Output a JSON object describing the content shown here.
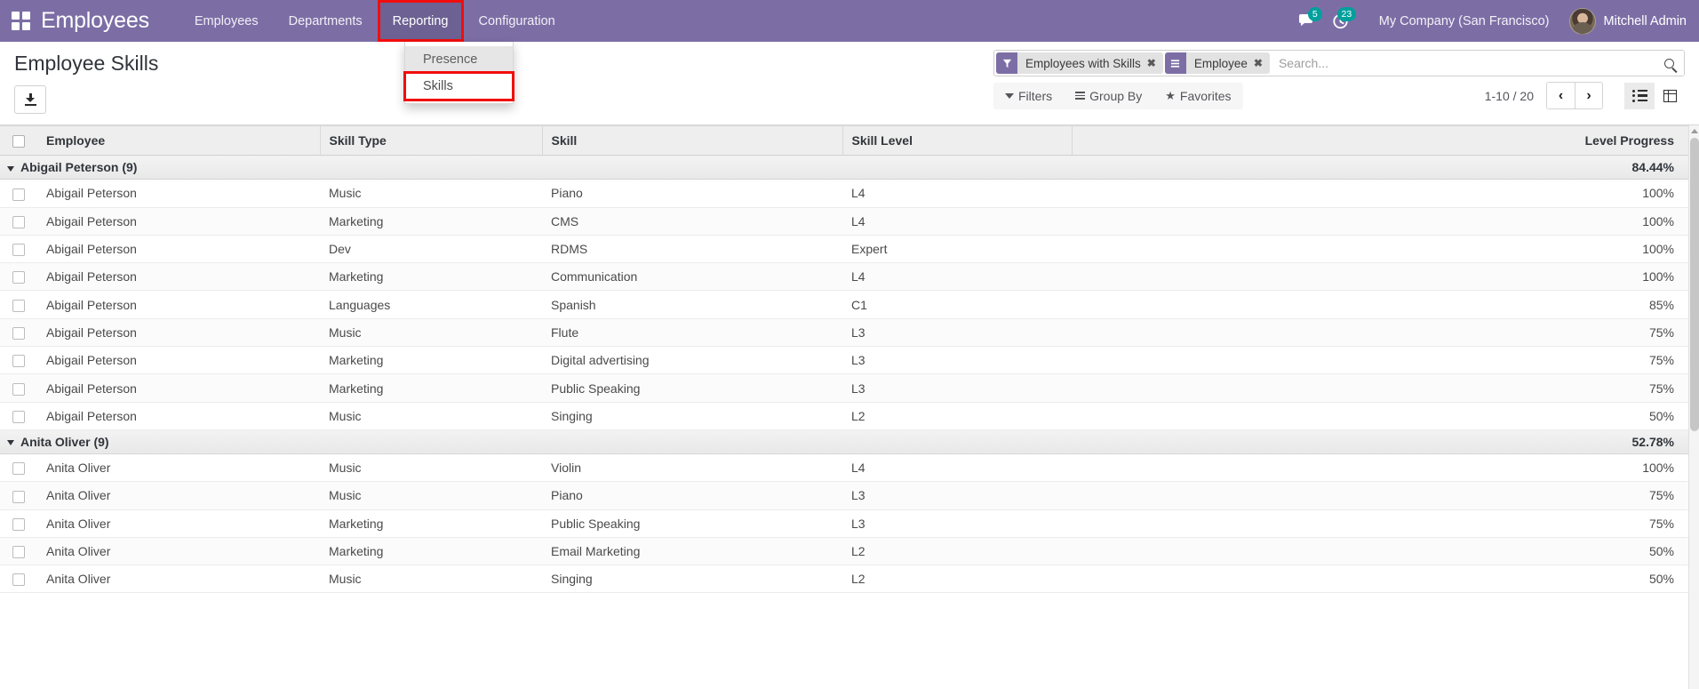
{
  "navbar": {
    "apps_icon": "apps-grid-icon",
    "brand": "Employees",
    "menu": [
      {
        "label": "Employees",
        "active": false
      },
      {
        "label": "Departments",
        "active": false
      },
      {
        "label": "Reporting",
        "active": true,
        "highlighted": true
      },
      {
        "label": "Configuration",
        "active": false
      }
    ],
    "messages_icon": "chat-bubble-icon",
    "messages_count": "5",
    "activities_icon": "clock-icon",
    "activities_count": "23",
    "company": "My Company (San Francisco)",
    "user_name": "Mitchell Admin",
    "accent_color": "#7c6ea5",
    "badge_color": "#00a09d"
  },
  "dropdown": {
    "items": [
      {
        "label": "Presence",
        "hovered": true,
        "highlighted": false
      },
      {
        "label": "Skills",
        "hovered": false,
        "highlighted": true
      }
    ]
  },
  "control_panel": {
    "title": "Employee Skills",
    "download_icon": "download-icon",
    "search": {
      "placeholder": "Search...",
      "value": "",
      "facets": [
        {
          "icon": "filter-funnel-icon",
          "label": "Employees with Skills",
          "remove": "✖"
        },
        {
          "icon": "group-by-icon",
          "label": "Employee",
          "remove": "✖"
        }
      ],
      "search_icon": "search-icon"
    },
    "filters_label": "Filters",
    "groupby_label": "Group By",
    "favorites_label": "Favorites",
    "pager": "1-10 / 20",
    "prev_label": "‹",
    "next_label": "›",
    "view_list_icon": "list-view-icon",
    "view_pivot_icon": "pivot-view-icon"
  },
  "table": {
    "columns": [
      "Employee",
      "Skill Type",
      "Skill",
      "Skill Level",
      "Level Progress"
    ],
    "groups": [
      {
        "name": "Abigail Peterson (9)",
        "progress": "84.44%",
        "rows": [
          {
            "employee": "Abigail Peterson",
            "skill_type": "Music",
            "skill": "Piano",
            "skill_level": "L4",
            "progress": "100%"
          },
          {
            "employee": "Abigail Peterson",
            "skill_type": "Marketing",
            "skill": "CMS",
            "skill_level": "L4",
            "progress": "100%"
          },
          {
            "employee": "Abigail Peterson",
            "skill_type": "Dev",
            "skill": "RDMS",
            "skill_level": "Expert",
            "progress": "100%"
          },
          {
            "employee": "Abigail Peterson",
            "skill_type": "Marketing",
            "skill": "Communication",
            "skill_level": "L4",
            "progress": "100%"
          },
          {
            "employee": "Abigail Peterson",
            "skill_type": "Languages",
            "skill": "Spanish",
            "skill_level": "C1",
            "progress": "85%"
          },
          {
            "employee": "Abigail Peterson",
            "skill_type": "Music",
            "skill": "Flute",
            "skill_level": "L3",
            "progress": "75%"
          },
          {
            "employee": "Abigail Peterson",
            "skill_type": "Marketing",
            "skill": "Digital advertising",
            "skill_level": "L3",
            "progress": "75%"
          },
          {
            "employee": "Abigail Peterson",
            "skill_type": "Marketing",
            "skill": "Public Speaking",
            "skill_level": "L3",
            "progress": "75%"
          },
          {
            "employee": "Abigail Peterson",
            "skill_type": "Music",
            "skill": "Singing",
            "skill_level": "L2",
            "progress": "50%"
          }
        ]
      },
      {
        "name": "Anita Oliver (9)",
        "progress": "52.78%",
        "rows": [
          {
            "employee": "Anita Oliver",
            "skill_type": "Music",
            "skill": "Violin",
            "skill_level": "L4",
            "progress": "100%"
          },
          {
            "employee": "Anita Oliver",
            "skill_type": "Music",
            "skill": "Piano",
            "skill_level": "L3",
            "progress": "75%"
          },
          {
            "employee": "Anita Oliver",
            "skill_type": "Marketing",
            "skill": "Public Speaking",
            "skill_level": "L3",
            "progress": "75%"
          },
          {
            "employee": "Anita Oliver",
            "skill_type": "Marketing",
            "skill": "Email Marketing",
            "skill_level": "L2",
            "progress": "50%"
          },
          {
            "employee": "Anita Oliver",
            "skill_type": "Music",
            "skill": "Singing",
            "skill_level": "L2",
            "progress": "50%"
          }
        ]
      }
    ]
  }
}
